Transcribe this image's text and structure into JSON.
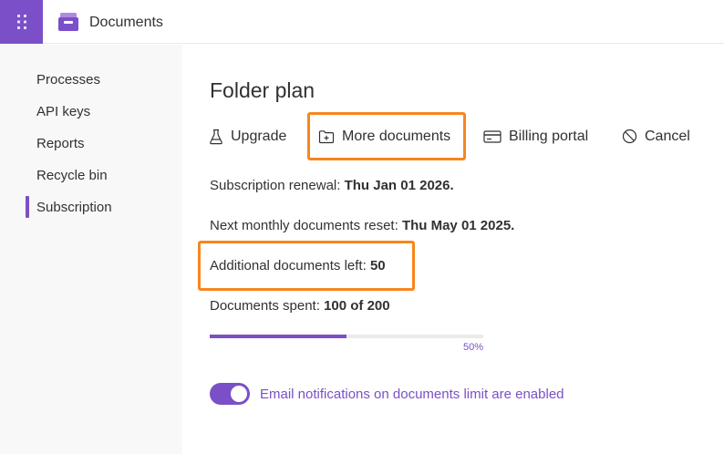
{
  "header": {
    "app_title": "Documents",
    "launcher_icon": "waffle-icon",
    "logo_icon": "inbox-tray-icon"
  },
  "sidebar": {
    "items": [
      {
        "label": "Processes"
      },
      {
        "label": "API keys"
      },
      {
        "label": "Reports"
      },
      {
        "label": "Recycle bin"
      },
      {
        "label": "Subscription",
        "active": true
      }
    ]
  },
  "main": {
    "title": "Folder plan",
    "actions": [
      {
        "label": "Upgrade",
        "icon": "flask-icon"
      },
      {
        "label": "More documents",
        "icon": "folder-add-icon"
      },
      {
        "label": "Billing portal",
        "icon": "credit-card-icon"
      },
      {
        "label": "Cancel",
        "icon": "prohibited-icon"
      }
    ],
    "renewal": {
      "label": "Subscription renewal: ",
      "value": "Thu Jan 01 2026",
      "suffix": "."
    },
    "reset": {
      "label": "Next monthly documents reset: ",
      "value": "Thu May 01 2025",
      "suffix": "."
    },
    "additional": {
      "label": "Additional documents left: ",
      "value": "50"
    },
    "spent": {
      "label": "Documents spent: ",
      "value": "100 of 200"
    },
    "progress": {
      "fraction": 0.5,
      "label": "50%"
    },
    "notifications": {
      "enabled": true,
      "label": "Email notifications on documents limit are enabled"
    }
  },
  "colors": {
    "accent": "#7b4fc7",
    "highlight": "#f7861e"
  }
}
